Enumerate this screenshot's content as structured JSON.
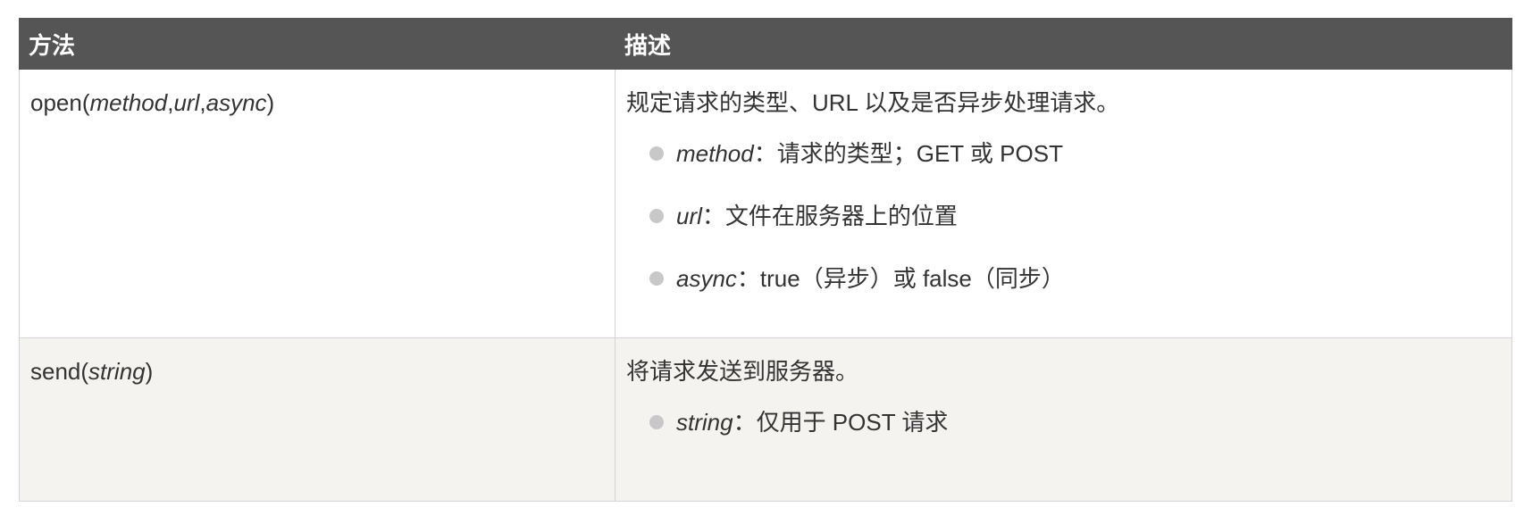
{
  "table": {
    "headers": [
      "方法",
      "描述"
    ],
    "rows": [
      {
        "method_name": "open(",
        "method_args": [
          "method",
          "url",
          "async"
        ],
        "method_sep": ",",
        "method_close": ")",
        "description": "规定请求的类型、URL 以及是否异步处理请求。",
        "params": [
          {
            "name": "method",
            "text": "：请求的类型；GET 或 POST"
          },
          {
            "name": "url",
            "text": "：文件在服务器上的位置"
          },
          {
            "name": "async",
            "text": "：true（异步）或 false（同步）"
          }
        ]
      },
      {
        "method_name": "send(",
        "method_args": [
          "string"
        ],
        "method_close": ")",
        "description": "将请求发送到服务器。",
        "params": [
          {
            "name": "string",
            "text": "：仅用于 POST 请求"
          }
        ]
      }
    ]
  },
  "colors": {
    "header_bg": "#555555",
    "header_text": "#ffffff",
    "alt_row_bg": "#f4f3f0",
    "bullet": "#c8c8c8",
    "border": "#d4d4d4"
  }
}
